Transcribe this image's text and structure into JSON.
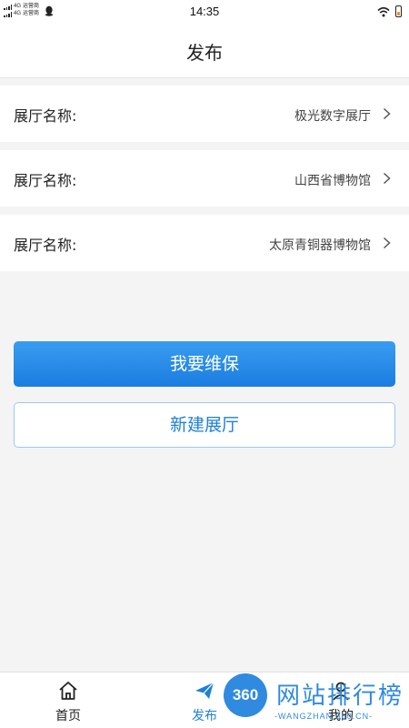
{
  "status_bar": {
    "time": "14:35",
    "sim1_network": "4G",
    "sim1_carrier": "运营商",
    "sim2_network": "4G",
    "sim2_carrier": "运营商"
  },
  "header": {
    "title": "发布"
  },
  "halls": [
    {
      "label": "展厅名称:",
      "value": "极光数字展厅"
    },
    {
      "label": "展厅名称:",
      "value": "山西省博物馆"
    },
    {
      "label": "展厅名称:",
      "value": "太原青铜器博物馆"
    }
  ],
  "actions": {
    "maintenance_label": "我要维保",
    "new_hall_label": "新建展厅"
  },
  "tab_bar": {
    "items": [
      {
        "label": "首页",
        "icon": "home-icon"
      },
      {
        "label": "发布",
        "icon": "paper-plane-icon",
        "active": true
      },
      {
        "label": "我的",
        "icon": "user-icon"
      }
    ]
  },
  "watermark": {
    "badge": "360",
    "title": "网站排行榜",
    "url": "-WANGZHAN.360.CN-"
  },
  "colors": {
    "accent": "#1f80d6",
    "primary_button": "#2a8ce8",
    "background": "#f4f4f4"
  }
}
